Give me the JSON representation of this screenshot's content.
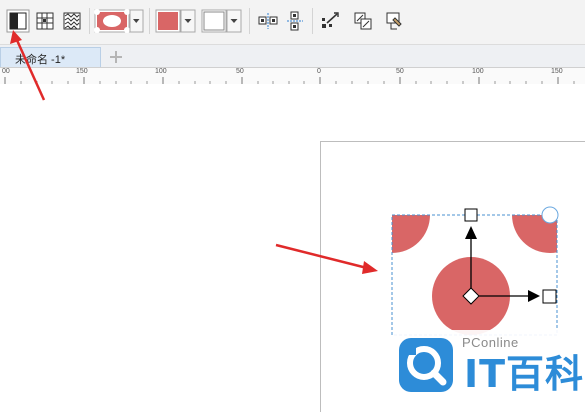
{
  "toolbar": {
    "buttons": [
      {
        "name": "toggle-half-button",
        "icon": "half-fill-square-icon"
      },
      {
        "name": "grid-fill-button",
        "icon": "grid-pattern-icon"
      },
      {
        "name": "texture-fill-button",
        "icon": "texture-pattern-icon"
      },
      {
        "name": "pattern-picker",
        "icon": "polka-dot-pattern-icon"
      },
      {
        "name": "foreground-color-picker",
        "icon": "color-swatch-icon",
        "color": "#d96666"
      },
      {
        "name": "background-color-picker",
        "icon": "color-swatch-icon",
        "color": "#ffffff"
      },
      {
        "name": "mirror-horizontal-button",
        "icon": "mirror-horizontal-icon"
      },
      {
        "name": "mirror-vertical-button",
        "icon": "mirror-vertical-icon"
      },
      {
        "name": "transform-button",
        "icon": "transform-edit-icon"
      },
      {
        "name": "copy-fill-button",
        "icon": "copy-fill-icon"
      },
      {
        "name": "fill-properties-button",
        "icon": "fill-properties-icon"
      }
    ]
  },
  "tabs": [
    {
      "label": "未命名 -1*",
      "active": true
    }
  ],
  "tab_add_icon": "plus-icon",
  "ruler": {
    "labels": [
      "00",
      "150",
      "100",
      "50",
      "0",
      "50",
      "100",
      "150"
    ]
  },
  "pattern": {
    "dot_color": "#d96666",
    "handle_color": "#000000"
  },
  "watermark": {
    "small": "PConline",
    "big": "IT百科",
    "logo_color": "#2d8cd8"
  }
}
